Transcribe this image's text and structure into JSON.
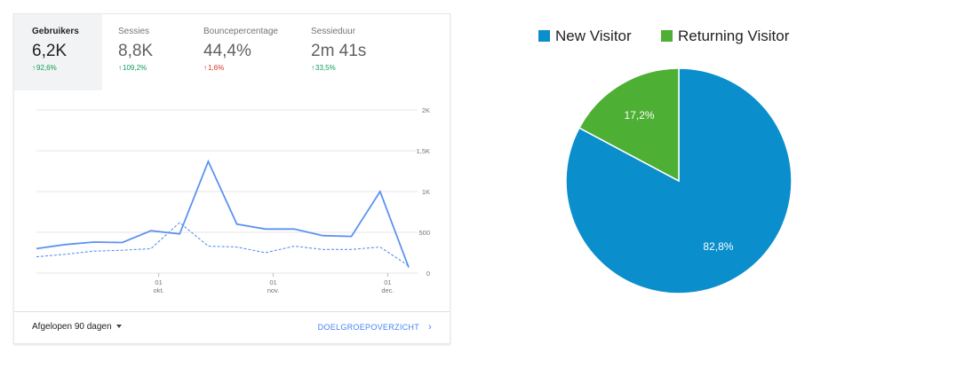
{
  "analytics_card": {
    "tabs": [
      {
        "label": "Gebruikers",
        "value": "6,2K",
        "delta": "92,6%",
        "direction": "up",
        "active": true
      },
      {
        "label": "Sessies",
        "value": "8,8K",
        "delta": "109,2%",
        "direction": "up",
        "active": false
      },
      {
        "label": "Bouncepercentage",
        "value": "44,4%",
        "delta": "1,6%",
        "direction": "up-bad",
        "active": false
      },
      {
        "label": "Sessieduur",
        "value": "2m 41s",
        "delta": "33,5%",
        "direction": "up",
        "active": false
      }
    ],
    "footer": {
      "date_range": "Afgelopen 90 dagen",
      "report_link": "DOELGROEPOVERZICHT"
    }
  },
  "chart_data": [
    {
      "type": "line",
      "y_ticks": [
        "2K",
        "1,5K",
        "1K",
        "500",
        "0"
      ],
      "ylim": [
        0,
        2000
      ],
      "x_ticks": [
        {
          "day": "01",
          "month": "okt."
        },
        {
          "day": "01",
          "month": "nov."
        },
        {
          "day": "01",
          "month": "dec."
        }
      ],
      "grid": true,
      "colors": {
        "current": "#5c93f0",
        "previous": "#5c93f0"
      },
      "series": [
        {
          "line_style": "solid",
          "values": [
            300,
            350,
            380,
            375,
            520,
            480,
            1370,
            600,
            540,
            540,
            460,
            450,
            1000,
            70
          ]
        },
        {
          "line_style": "dashed",
          "values": [
            200,
            230,
            270,
            280,
            300,
            620,
            330,
            320,
            250,
            330,
            290,
            290,
            320,
            90
          ]
        }
      ]
    },
    {
      "type": "pie",
      "legend_position": "top",
      "slices": [
        {
          "name": "New Visitor",
          "value": 82.8,
          "label": "82,8%",
          "color": "#0a8ecc"
        },
        {
          "name": "Returning Visitor",
          "value": 17.2,
          "label": "17,2%",
          "color": "#4daf34"
        }
      ]
    }
  ]
}
